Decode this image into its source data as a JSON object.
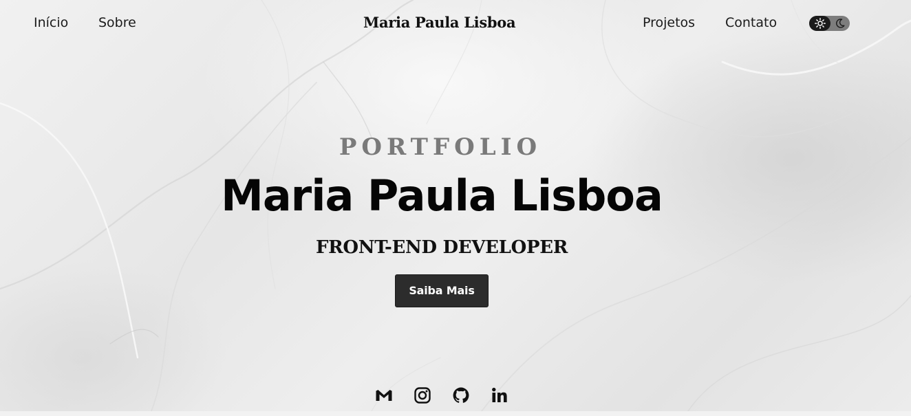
{
  "nav": {
    "left_links": [
      "Início",
      "Sobre"
    ],
    "brand": "Maria Paula Lisboa",
    "right_links": [
      "Projetos",
      "Contato"
    ],
    "theme_toggle": {
      "icons": [
        "sun-icon",
        "moon-icon"
      ],
      "active": "light"
    }
  },
  "hero": {
    "kicker": "PORTFOLIO",
    "name": "Maria Paula Lisboa",
    "role": "FRONT-END DEVELOPER",
    "cta_label": "Saiba Mais"
  },
  "social": {
    "icons": [
      "gmail-icon",
      "instagram-icon",
      "github-icon",
      "linkedin-icon"
    ]
  },
  "colors": {
    "text": "#111111",
    "kicker": "#7a7a7a",
    "button_bg": "#2c2c2c",
    "button_text": "#ffffff",
    "toggle_track": "#7d7d7d",
    "toggle_knob": "#1b1b1b"
  }
}
